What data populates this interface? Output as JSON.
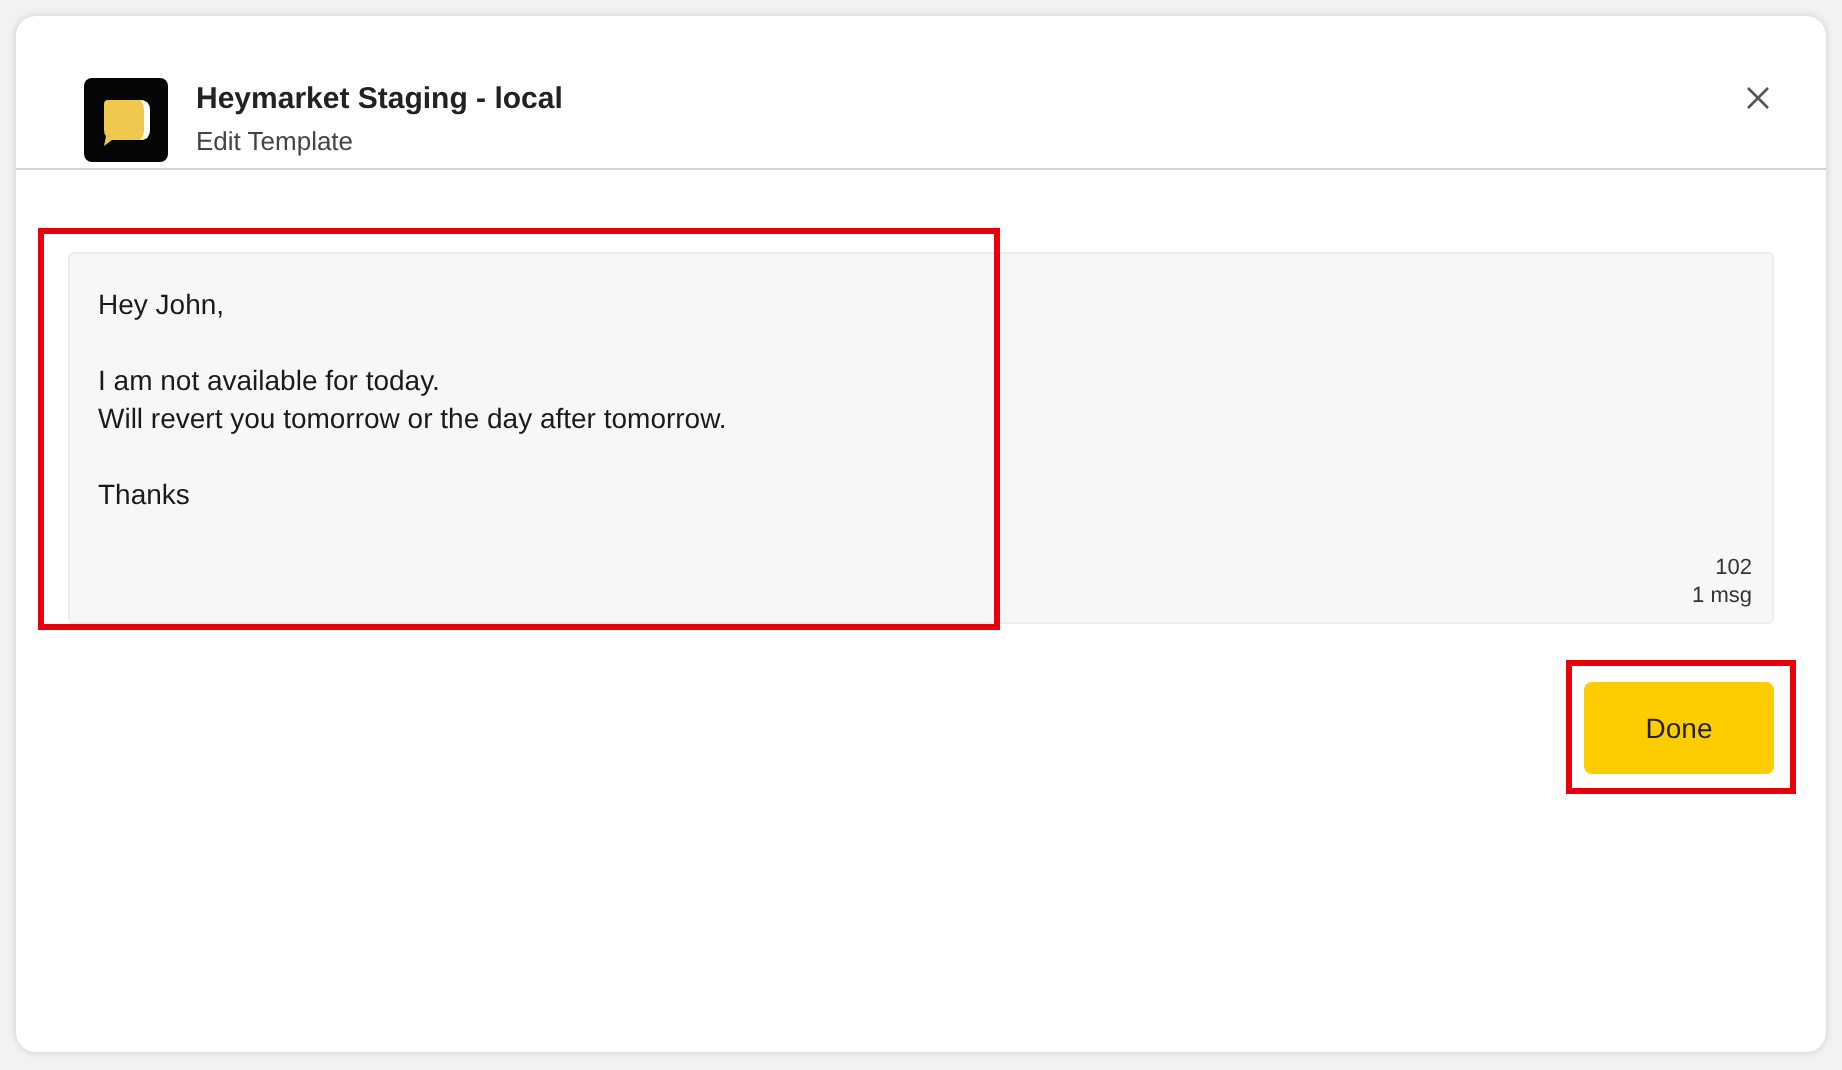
{
  "header": {
    "title": "Heymarket Staging - local",
    "subtitle": "Edit Template"
  },
  "editor": {
    "value": "Hey John,\n\nI am not available for today.\nWill revert you tomorrow or the day after tomorrow.\n\nThanks",
    "char_count": "102",
    "msg_count": "1 msg",
    "highlighted": true
  },
  "done_button": {
    "label": "Done",
    "highlighted": true
  }
}
